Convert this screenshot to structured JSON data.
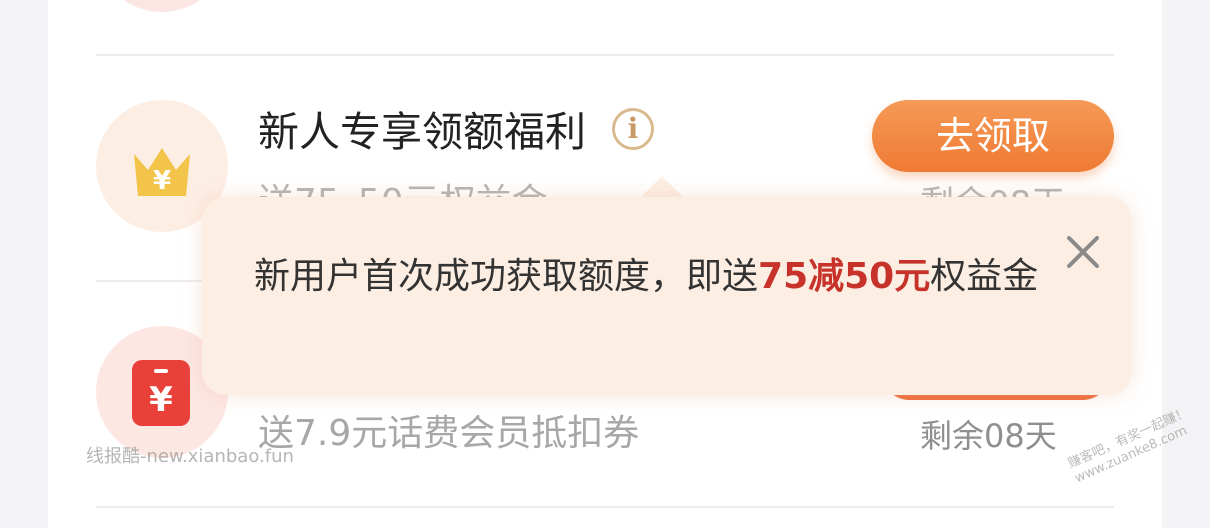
{
  "items": [
    {
      "title": "新人专享领额福利",
      "info_icon": "i",
      "button_label": "去领取",
      "subtitle": "送75_50元权益金",
      "remaining": "剩余08天"
    },
    {
      "subtitle": "送7.9元话费会员抵扣券",
      "remaining": "剩余08天"
    }
  ],
  "tooltip": {
    "text_before": "新用户首次成功获取额度，即送",
    "highlight": "75减50元",
    "text_after": "权益金"
  },
  "icons": {
    "crown_yen": "¥",
    "phone_yen": "¥"
  },
  "watermarks": {
    "left": "线报酷-new.xianbao.fun",
    "right_line1": "赚客吧，有奖一起赚！",
    "right_line2": "www.zuanke8.com"
  },
  "colors": {
    "accent": "#ef7a33",
    "highlight": "#c7332a",
    "tooltip_bg": "#fdeee3"
  }
}
